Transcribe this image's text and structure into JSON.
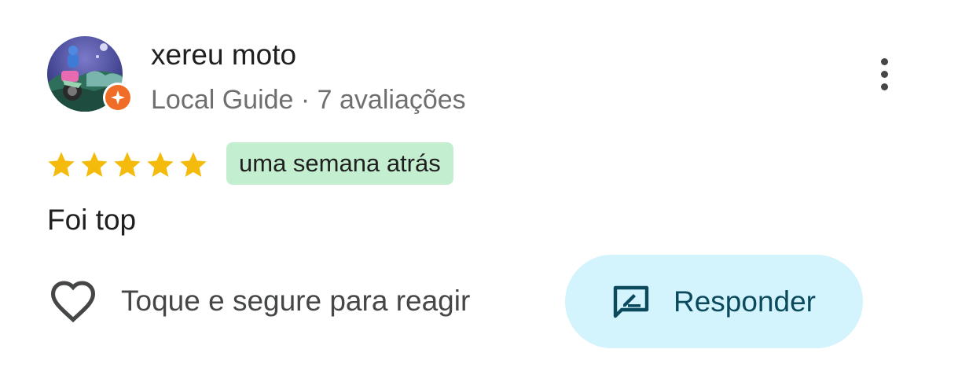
{
  "review": {
    "author": {
      "name": "xereu moto",
      "meta": "Local Guide · 7 avaliações",
      "avatar_icon": "profile-photo-motorcycle-illustration",
      "badge_icon": "local-guide-star-icon",
      "badge_color": "#f06d28"
    },
    "more_icon": "more-vert-icon",
    "rating": {
      "stars": 5,
      "max": 5,
      "star_color": "#f5bb0c"
    },
    "time_chip": {
      "label": "uma semana atrás",
      "color": "#c4eed0"
    },
    "text": "Foi top",
    "actions": {
      "react": {
        "icon": "heart-outline-icon",
        "label": "Toque e segure para reagir"
      },
      "reply": {
        "icon": "reply-review-icon",
        "label": "Responder",
        "background": "#d3f3fd",
        "text_color": "#0b4a5c"
      }
    }
  }
}
